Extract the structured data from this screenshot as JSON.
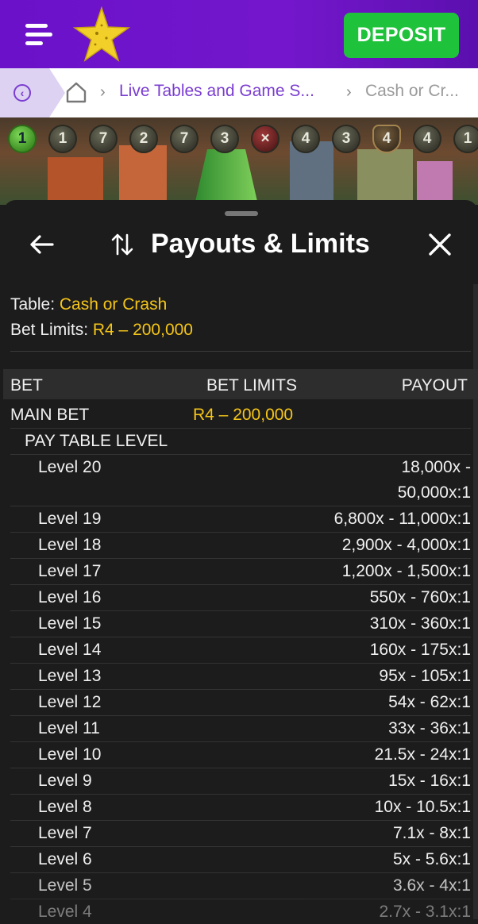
{
  "header": {
    "deposit_label": "DEPOSIT",
    "brand_color": "#6a11c9",
    "deposit_color": "#1fc23b"
  },
  "breadcrumb": {
    "items": [
      "Live Tables and Game S...",
      "Cash or Cr..."
    ]
  },
  "game_strip": {
    "balls": [
      "1",
      "1",
      "7",
      "2",
      "7",
      "3",
      "×",
      "4",
      "3",
      "4",
      "4",
      "1"
    ]
  },
  "panel": {
    "title": "Payouts & Limits",
    "table_label": "Table:",
    "table_value": "Cash or Crash",
    "bet_limits_label": "Bet Limits:",
    "bet_limits_value": "R4 – 200,000",
    "columns": {
      "bet": "BET",
      "limits": "BET LIMITS",
      "payout": "PAYOUT"
    },
    "main_bet": {
      "name": "MAIN BET",
      "limits": "R4 – 200,000"
    },
    "pay_table_label": "PAY TABLE LEVEL",
    "levels": [
      {
        "name": "Level 20",
        "payout_line1": "18,000x -",
        "payout_line2": "50,000x:1"
      },
      {
        "name": "Level 19",
        "payout": "6,800x - 11,000x:1"
      },
      {
        "name": "Level 18",
        "payout": "2,900x - 4,000x:1"
      },
      {
        "name": "Level 17",
        "payout": "1,200x - 1,500x:1"
      },
      {
        "name": "Level 16",
        "payout": "550x - 760x:1"
      },
      {
        "name": "Level 15",
        "payout": "310x - 360x:1"
      },
      {
        "name": "Level 14",
        "payout": "160x - 175x:1"
      },
      {
        "name": "Level 13",
        "payout": "95x - 105x:1"
      },
      {
        "name": "Level 12",
        "payout": "54x - 62x:1"
      },
      {
        "name": "Level 11",
        "payout": "33x - 36x:1"
      },
      {
        "name": "Level 10",
        "payout": "21.5x - 24x:1"
      },
      {
        "name": "Level 9",
        "payout": "15x - 16x:1"
      },
      {
        "name": "Level 8",
        "payout": "10x - 10.5x:1"
      },
      {
        "name": "Level 7",
        "payout": "7.1x - 8x:1"
      },
      {
        "name": "Level 6",
        "payout": "5x - 5.6x:1"
      },
      {
        "name": "Level 5",
        "payout": "3.6x - 4x:1"
      },
      {
        "name": "Level 4",
        "payout": "2.7x - 3.1x:1"
      }
    ],
    "accent_color": "#f5c518"
  }
}
